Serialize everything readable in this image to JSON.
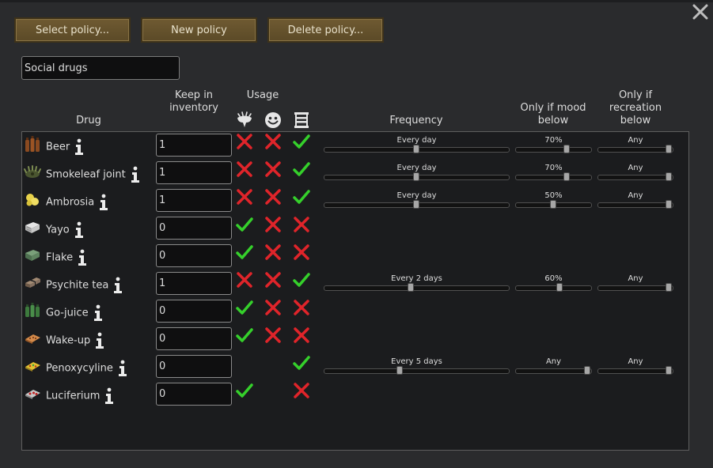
{
  "toolbar": {
    "select_label": "Select policy...",
    "new_label": "New policy",
    "delete_label": "Delete policy..."
  },
  "policy_name": "Social drugs",
  "headers": {
    "drug": "Drug",
    "keep_line1": "Keep in",
    "keep_line2": "inventory",
    "usage": "Usage",
    "frequency": "Frequency",
    "mood_line1": "Only if mood",
    "mood_line2": "below",
    "rec_line1": "Only if",
    "rec_line2": "recreation",
    "rec_line3": "below",
    "usage_icons": [
      "joy-icon",
      "smiley-icon",
      "schedule-icon"
    ]
  },
  "colors": {
    "check": "#35d02b",
    "cross": "#e0242a",
    "button": "#6f5a32",
    "panel": "#1b1c1e"
  },
  "rows": [
    {
      "name": "Beer",
      "icon": "beer-icon",
      "inventory": "1",
      "usage": [
        "cross",
        "cross",
        "check"
      ],
      "has_sliders": true,
      "frequency": "Every day",
      "frequency_pos": 0.5,
      "mood": "70%",
      "mood_pos": 0.7,
      "recreation": "Any",
      "rec_pos": 1
    },
    {
      "name": "Smokeleaf joint",
      "icon": "smokeleaf-icon",
      "inventory": "1",
      "usage": [
        "cross",
        "cross",
        "check"
      ],
      "has_sliders": true,
      "frequency": "Every day",
      "frequency_pos": 0.5,
      "mood": "70%",
      "mood_pos": 0.7,
      "recreation": "Any",
      "rec_pos": 1
    },
    {
      "name": "Ambrosia",
      "icon": "ambrosia-icon",
      "inventory": "1",
      "usage": [
        "cross",
        "cross",
        "check"
      ],
      "has_sliders": true,
      "frequency": "Every day",
      "frequency_pos": 0.5,
      "mood": "50%",
      "mood_pos": 0.5,
      "recreation": "Any",
      "rec_pos": 1
    },
    {
      "name": "Yayo",
      "icon": "yayo-icon",
      "inventory": "0",
      "usage": [
        "check",
        "cross",
        "cross"
      ],
      "has_sliders": false
    },
    {
      "name": "Flake",
      "icon": "flake-icon",
      "inventory": "0",
      "usage": [
        "check",
        "cross",
        "cross"
      ],
      "has_sliders": false
    },
    {
      "name": "Psychite tea",
      "icon": "psychite-tea-icon",
      "inventory": "1",
      "usage": [
        "cross",
        "cross",
        "check"
      ],
      "has_sliders": true,
      "frequency": "Every 2 days",
      "frequency_pos": 0.47,
      "mood": "60%",
      "mood_pos": 0.6,
      "recreation": "Any",
      "rec_pos": 1
    },
    {
      "name": "Go-juice",
      "icon": "go-juice-icon",
      "inventory": "0",
      "usage": [
        "check",
        "cross",
        "cross"
      ],
      "has_sliders": false
    },
    {
      "name": "Wake-up",
      "icon": "wake-up-icon",
      "inventory": "0",
      "usage": [
        "check",
        "cross",
        "cross"
      ],
      "has_sliders": false
    },
    {
      "name": "Penoxycyline",
      "icon": "penoxycyline-icon",
      "inventory": "0",
      "usage": [
        "none",
        "none",
        "check"
      ],
      "has_sliders": true,
      "frequency": "Every 5 days",
      "frequency_pos": 0.41,
      "mood": "Any",
      "mood_pos": 1,
      "recreation": "Any",
      "rec_pos": 1
    },
    {
      "name": "Luciferium",
      "icon": "luciferium-icon",
      "inventory": "0",
      "usage": [
        "check",
        "none",
        "cross"
      ],
      "has_sliders": false
    }
  ]
}
